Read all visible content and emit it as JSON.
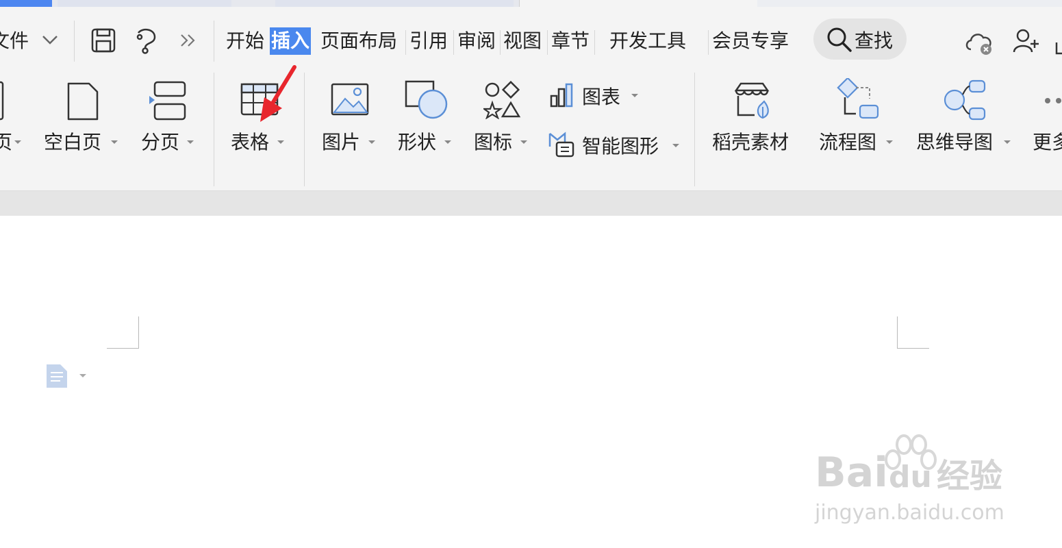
{
  "menu": {
    "file": "文件",
    "tabs": {
      "start": "开始",
      "insert": "插入",
      "page_layout": "页面布局",
      "reference": "引用",
      "review": "审阅",
      "view": "视图",
      "section": "章节",
      "dev_tools": "开发工具",
      "member": "会员专享"
    },
    "active_tab": "insert",
    "search": "查找"
  },
  "ribbon": {
    "cover_page": "页",
    "blank_page": "空白页",
    "page_break": "分页",
    "table": "表格",
    "picture": "图片",
    "shape": "形状",
    "icon": "图标",
    "chart": "图表",
    "smart_art": "智能图形",
    "docer": "稻壳素材",
    "flowchart": "流程图",
    "mindmap": "思维导图",
    "more": "更多"
  },
  "watermark": {
    "brand_a": "Bai",
    "brand_b": "du",
    "brand_c": "经验",
    "url": "jingyan.baidu.com"
  },
  "colors": {
    "accent": "#4a88ee",
    "annotation_arrow": "#e8262d",
    "icon_blue": "#5b8fd6"
  }
}
